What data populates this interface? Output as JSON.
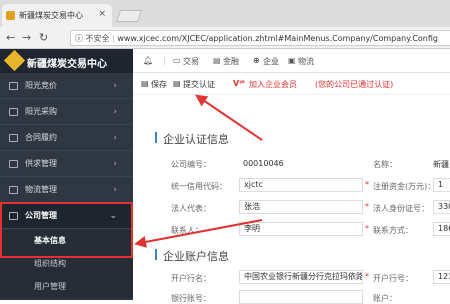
{
  "browser": {
    "tab_title": "新疆煤炭交易中心",
    "tab_close": "×",
    "security": "不安全",
    "url": "www.xjcec.com/XJCEC/application.zhtml#MainMenus.Company/Company.Config"
  },
  "sidebar": {
    "brand": "新疆煤炭交易中心",
    "items": [
      {
        "label": "阳光竞价"
      },
      {
        "label": "阳光采购"
      },
      {
        "label": "合同履约"
      },
      {
        "label": "供求管理"
      },
      {
        "label": "物流管理"
      },
      {
        "label": "公司管理"
      }
    ],
    "sub_items": [
      {
        "label": "基本信息"
      },
      {
        "label": "组织结构"
      },
      {
        "label": "用户管理"
      }
    ]
  },
  "topnav": {
    "items": [
      {
        "label": "交易"
      },
      {
        "label": "金融"
      },
      {
        "label": "企业"
      },
      {
        "label": "物流"
      }
    ]
  },
  "toolbar": {
    "save": "保存",
    "submit": "提交认证",
    "join": "加入企业会员",
    "notice": "(您的公司已通过认证)"
  },
  "form": {
    "section1": "企业认证信息",
    "section2": "企业账户信息",
    "fields": {
      "company_no_label": "公司编号：",
      "company_no_value": "00010046",
      "name_label": "名称：",
      "name_value": "新疆",
      "credit_code_label": "统一信用代码：",
      "credit_code_value": "xjctc",
      "reg_capital_label": "注册资金(万元)：",
      "reg_capital_value": "1",
      "legal_rep_label": "法人代表：",
      "legal_rep_value": "张浩",
      "legal_id_label": "法人身份证号：",
      "legal_id_value": "330",
      "contact_label": "联系人：",
      "contact_value": "李明",
      "contact_phone_label": "联系方式：",
      "contact_phone_value": "186",
      "bank_name_label": "开户行名：",
      "bank_name_value": "中国农业银行新疆分行克拉玛依路",
      "bank_no_label": "开户行号：",
      "bank_no_value": "123",
      "bank_account_label": "银行账号：",
      "bank_account_value": "",
      "account_type_label": "账户："
    },
    "required_mark": "*"
  },
  "colors": {
    "sidebar_bg": "#2f3742",
    "highlight_red": "#e23232",
    "accent_blue": "#3b82c4"
  }
}
